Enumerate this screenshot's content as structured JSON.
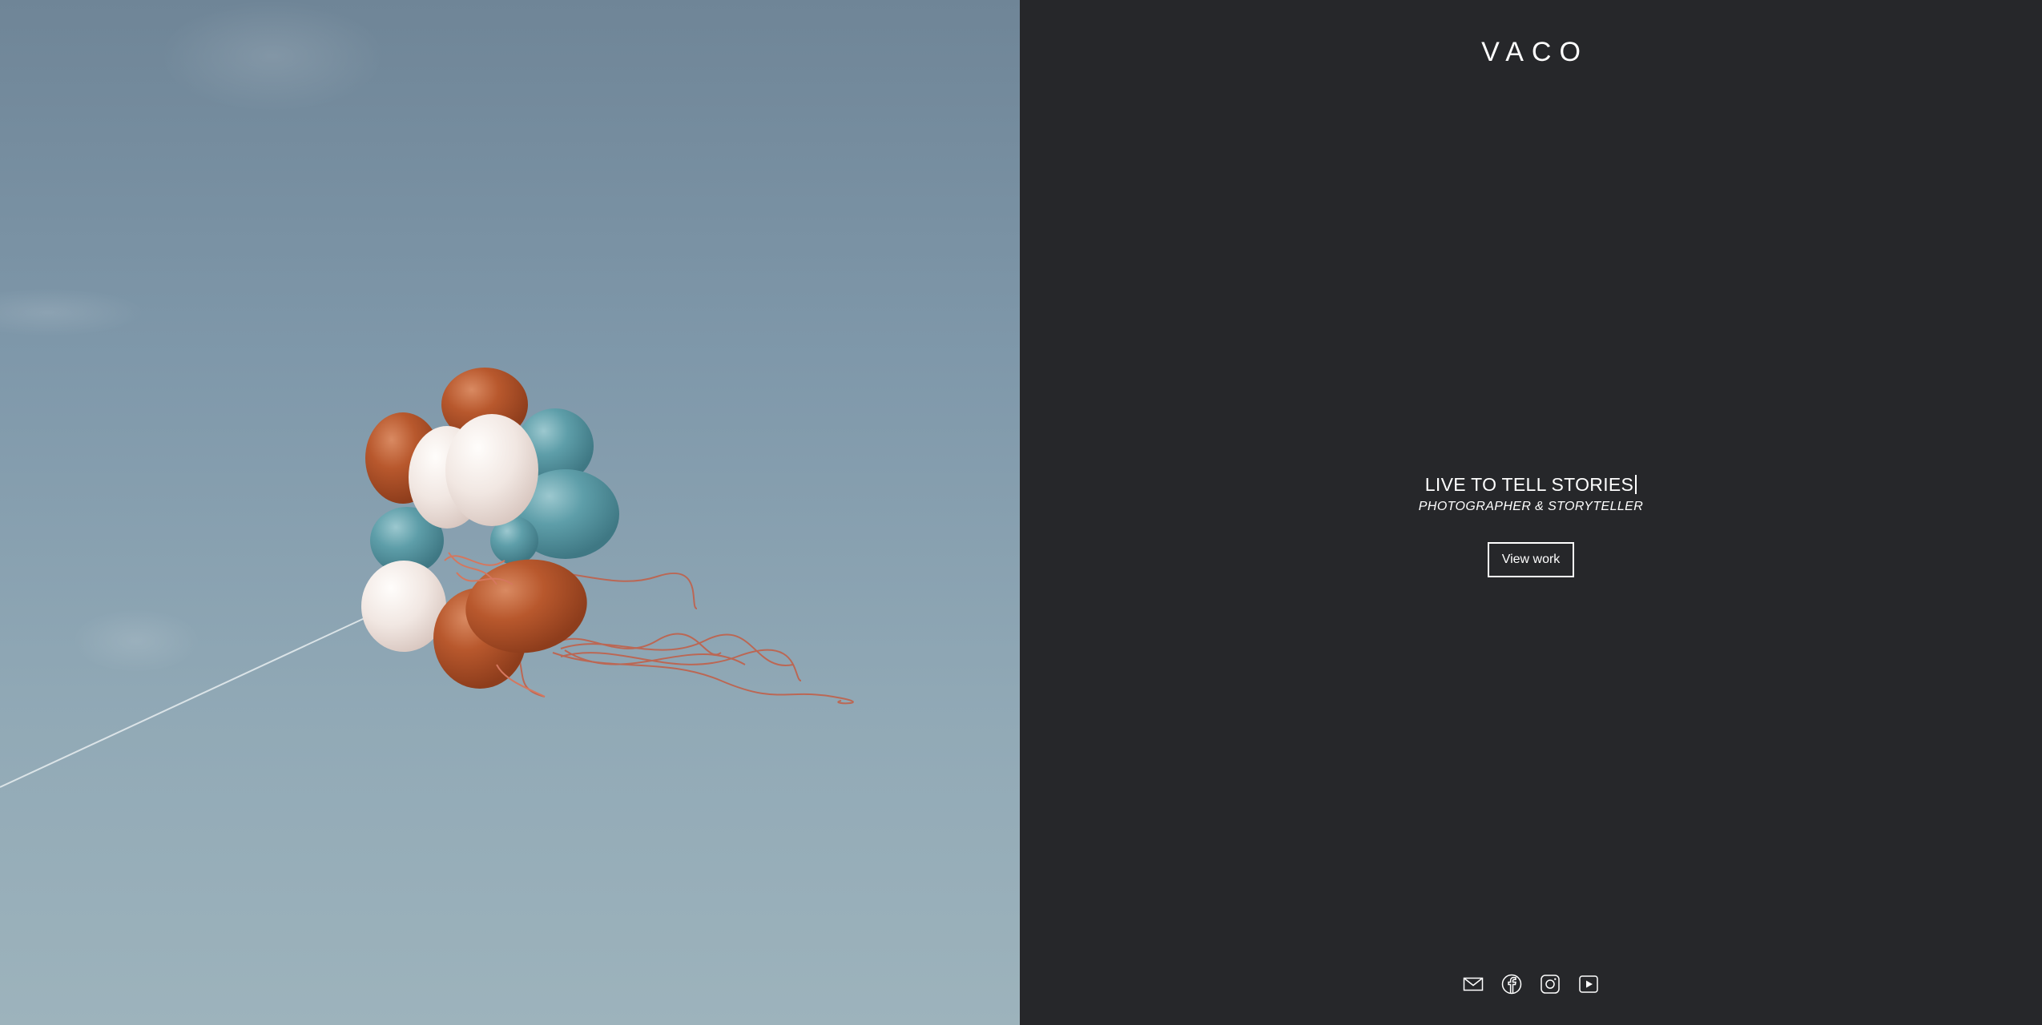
{
  "brand": {
    "logo_text": "VACO"
  },
  "hero": {
    "image_alt": "Bunch of balloons floating in the sky",
    "headline": "LIVE TO TELL STORIES",
    "tagline": "PHOTOGRAPHER & STORYTELLER",
    "cta_label": "View work"
  },
  "social": {
    "items": [
      {
        "icon": "mail-icon"
      },
      {
        "icon": "facebook-icon"
      },
      {
        "icon": "instagram-icon"
      },
      {
        "icon": "youtube-icon"
      }
    ]
  },
  "colors": {
    "panel_bg": "#26272a",
    "text": "#ffffff",
    "sky": "#7f98aa",
    "balloon_orange": "#b4532a",
    "balloon_teal": "#5a9aa6",
    "balloon_white": "#efe6e0"
  }
}
